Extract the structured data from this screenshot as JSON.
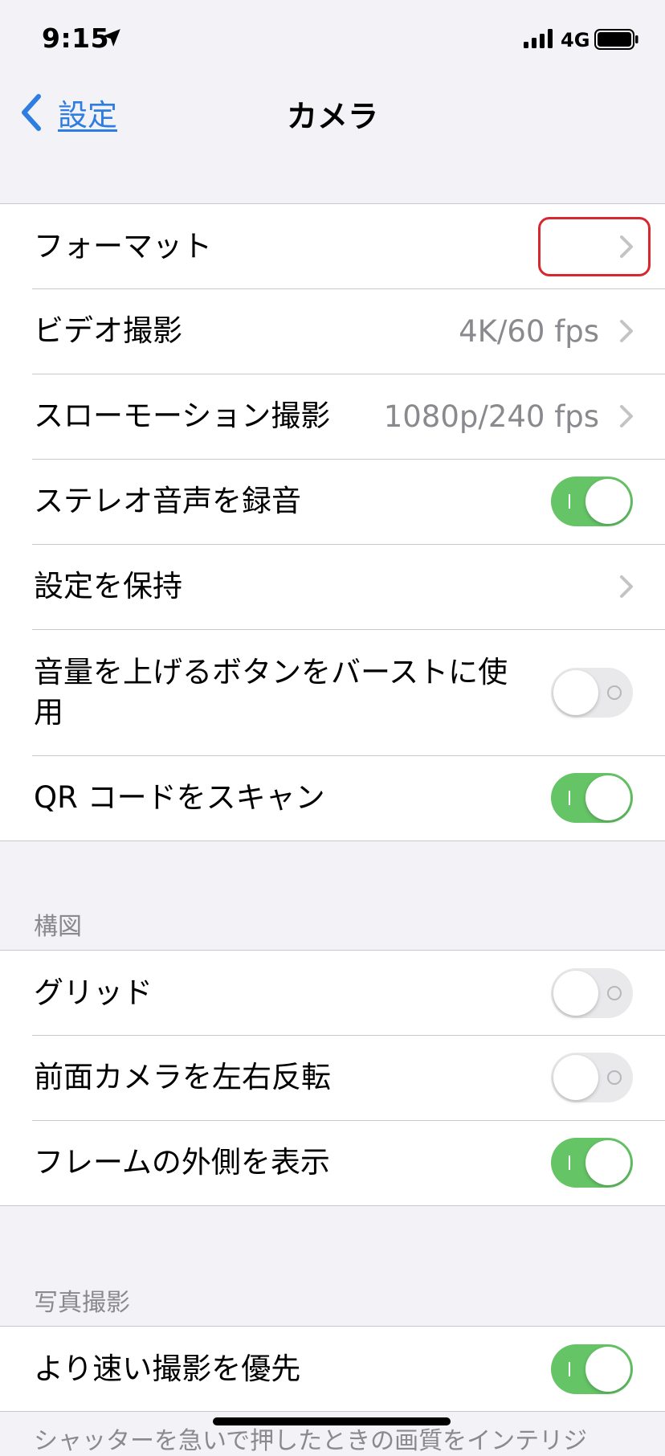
{
  "status_bar": {
    "time": "9:15",
    "network": "4G"
  },
  "nav": {
    "back_label": "設定",
    "title": "カメラ"
  },
  "group1": {
    "format": {
      "label": "フォーマット"
    },
    "video": {
      "label": "ビデオ撮影",
      "value": "4K/60 fps"
    },
    "slomo": {
      "label": "スローモーション撮影",
      "value": "1080p/240 fps"
    },
    "stereo": {
      "label": "ステレオ音声を録音",
      "on": true
    },
    "preserve": {
      "label": "設定を保持"
    },
    "burst": {
      "label": "音量を上げるボタンをバーストに使用",
      "on": false
    },
    "qr": {
      "label": "QR コードをスキャン",
      "on": true
    }
  },
  "composition": {
    "header": "構図",
    "grid": {
      "label": "グリッド",
      "on": false
    },
    "mirror": {
      "label": "前面カメラを左右反転",
      "on": false
    },
    "outside": {
      "label": "フレームの外側を表示",
      "on": true
    }
  },
  "photo": {
    "header": "写真撮影",
    "faster": {
      "label": "より速い撮影を優先",
      "on": true
    },
    "footer": "シャッターを急いで押したときの画質をインテリジ"
  },
  "colors": {
    "accent": "#2f7de1",
    "toggle_on": "#65c466",
    "highlight": "#d7272f"
  }
}
